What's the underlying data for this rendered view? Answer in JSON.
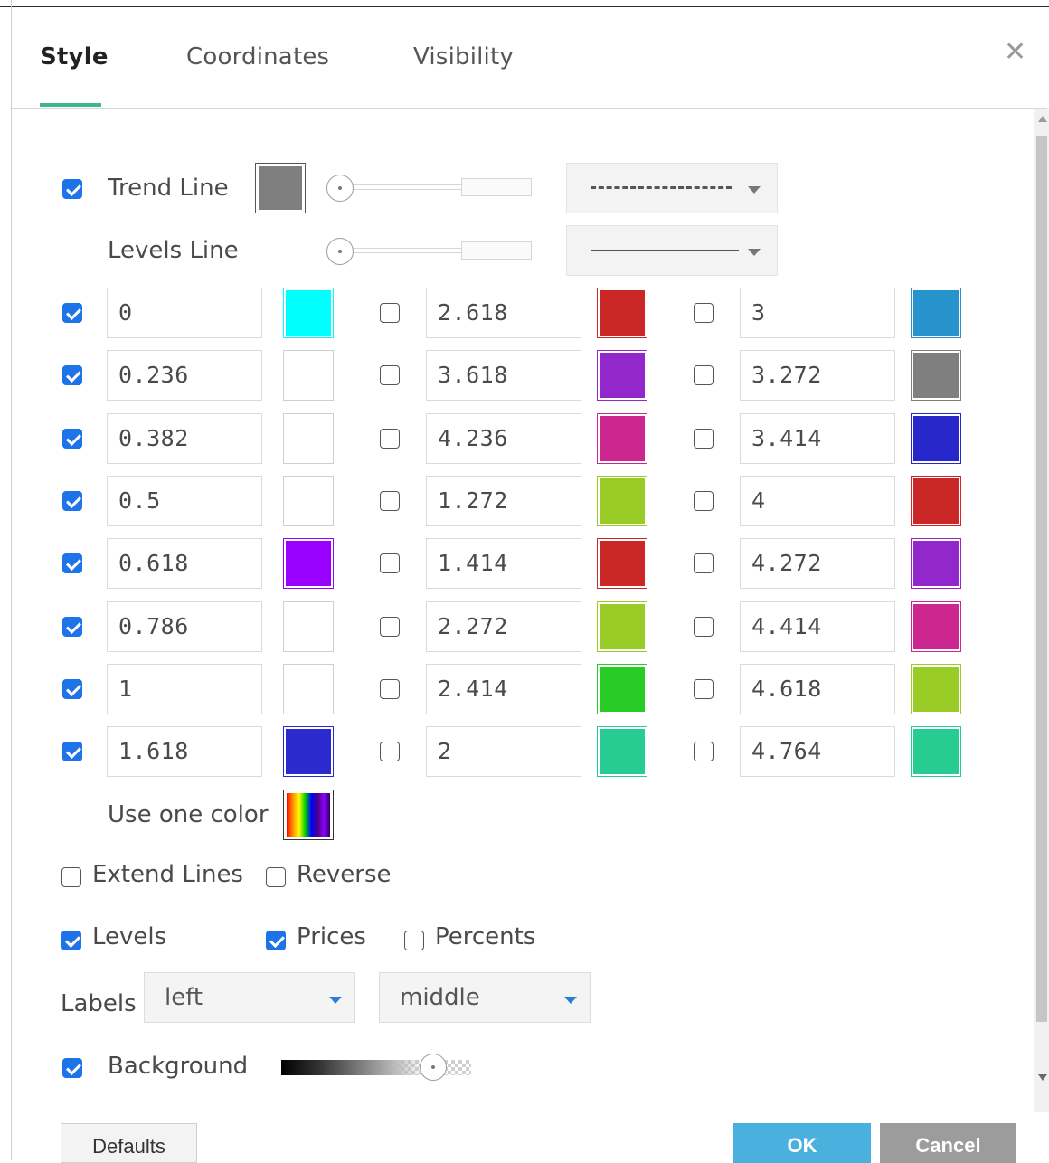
{
  "tabs": [
    {
      "label": "Style",
      "active": true
    },
    {
      "label": "Coordinates",
      "active": false
    },
    {
      "label": "Visibility",
      "active": false
    }
  ],
  "close_icon": "close-icon",
  "trend_line": {
    "label": "Trend Line",
    "checked": true,
    "color": "#7f7f7f",
    "style": "dashed"
  },
  "levels_line": {
    "label": "Levels Line",
    "style": "solid"
  },
  "columns": [
    {
      "levels": [
        {
          "value": "0",
          "checked": true,
          "color": "#00ffff"
        },
        {
          "value": "0.236",
          "checked": true,
          "color": "#ffffff"
        },
        {
          "value": "0.382",
          "checked": true,
          "color": "#ffffff"
        },
        {
          "value": "0.5",
          "checked": true,
          "color": "#ffffff"
        },
        {
          "value": "0.618",
          "checked": true,
          "color": "#9900ff"
        },
        {
          "value": "0.786",
          "checked": true,
          "color": "#ffffff"
        },
        {
          "value": "1",
          "checked": true,
          "color": "#ffffff"
        },
        {
          "value": "1.618",
          "checked": true,
          "color": "#2a2acf"
        }
      ]
    },
    {
      "levels": [
        {
          "value": "2.618",
          "checked": false,
          "color": "#cc2727"
        },
        {
          "value": "3.618",
          "checked": false,
          "color": "#9227cc"
        },
        {
          "value": "4.236",
          "checked": false,
          "color": "#cc2790"
        },
        {
          "value": "1.272",
          "checked": false,
          "color": "#99cc27"
        },
        {
          "value": "1.414",
          "checked": false,
          "color": "#cc2727"
        },
        {
          "value": "2.272",
          "checked": false,
          "color": "#99cc27"
        },
        {
          "value": "2.414",
          "checked": false,
          "color": "#27cc27"
        },
        {
          "value": "2",
          "checked": false,
          "color": "#27cc92"
        }
      ]
    },
    {
      "levels": [
        {
          "value": "3",
          "checked": false,
          "color": "#2793cc"
        },
        {
          "value": "3.272",
          "checked": false,
          "color": "#7f7f7f"
        },
        {
          "value": "3.414",
          "checked": false,
          "color": "#2727cc"
        },
        {
          "value": "4",
          "checked": false,
          "color": "#cc2727"
        },
        {
          "value": "4.272",
          "checked": false,
          "color": "#9227cc"
        },
        {
          "value": "4.414",
          "checked": false,
          "color": "#cc2790"
        },
        {
          "value": "4.618",
          "checked": false,
          "color": "#99cc27"
        },
        {
          "value": "4.764",
          "checked": false,
          "color": "#27cc92"
        }
      ]
    }
  ],
  "use_one_color": {
    "label": "Use one color"
  },
  "extend_lines": {
    "label": "Extend Lines",
    "checked": false
  },
  "reverse": {
    "label": "Reverse",
    "checked": false
  },
  "levels_toggle": {
    "label": "Levels",
    "checked": true
  },
  "prices_toggle": {
    "label": "Prices",
    "checked": true
  },
  "percents_toggle": {
    "label": "Percents",
    "checked": false
  },
  "labels": {
    "label": "Labels",
    "horizontal": "left",
    "vertical": "middle"
  },
  "background": {
    "label": "Background",
    "checked": true,
    "opacity_level": 0.8
  },
  "buttons": {
    "defaults": "Defaults",
    "ok": "OK",
    "cancel": "Cancel"
  },
  "accent_color": "#3fb68b",
  "checkbox_color": "#1e73e8"
}
